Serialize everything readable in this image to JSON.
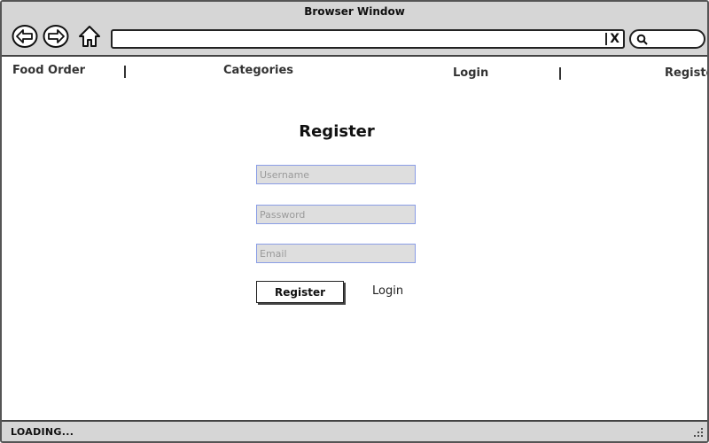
{
  "window": {
    "title": "Browser Window"
  },
  "toolbar": {
    "back_icon": "arrow-left-circle-icon",
    "forward_icon": "arrow-right-circle-icon",
    "home_icon": "home-icon",
    "url_value": "",
    "clear_label": "X",
    "search_icon": "search-icon"
  },
  "topnav": {
    "brand": "Food Order",
    "categories": "Categories",
    "login": "Login",
    "register": "Register"
  },
  "form": {
    "title": "Register",
    "username_placeholder": "Username",
    "password_placeholder": "Password",
    "email_placeholder": "Email",
    "submit_label": "Register",
    "login_link": "Login"
  },
  "status": {
    "text": "LOADING..."
  },
  "colors": {
    "chrome_bg": "#d6d6d6",
    "field_bg": "#dedede",
    "field_border": "#8a9de6"
  }
}
